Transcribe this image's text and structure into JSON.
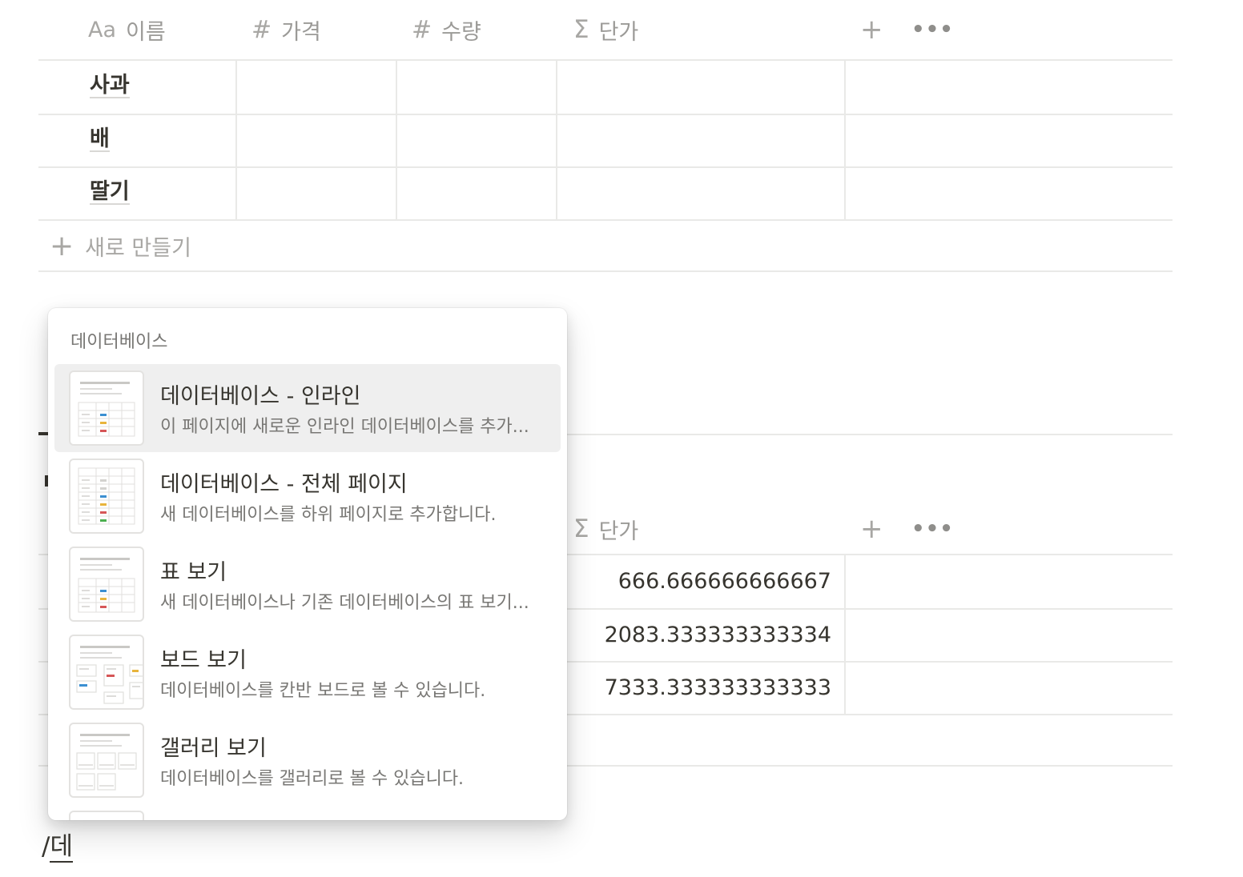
{
  "table1": {
    "headers": [
      {
        "icon": "Aa",
        "label": "이름"
      },
      {
        "icon": "#",
        "label": "가격"
      },
      {
        "icon": "#",
        "label": "수량"
      },
      {
        "icon": "Σ",
        "label": "단가"
      }
    ],
    "add_column": "+",
    "more": "•••",
    "rows": [
      {
        "name": "사과"
      },
      {
        "name": "배"
      },
      {
        "name": "딸기"
      }
    ],
    "new_row_plus": "+",
    "new_row_label": "새로 만들기"
  },
  "table2": {
    "header": {
      "icon": "Σ",
      "label": "단가"
    },
    "add_column": "+",
    "more": "•••",
    "values": [
      "666.666666666667",
      "2083.333333333334",
      "7333.333333333333"
    ]
  },
  "menu": {
    "heading": "데이터베이스",
    "items": [
      {
        "title": "데이터베이스 - 인라인",
        "desc": "이 페이지에 새로운 인라인 데이터베이스를 추가...",
        "icon": "inline-database-thumbnail"
      },
      {
        "title": "데이터베이스 - 전체 페이지",
        "desc": "새 데이터베이스를 하위 페이지로 추가합니다.",
        "icon": "full-page-database-thumbnail"
      },
      {
        "title": "표 보기",
        "desc": "새 데이터베이스나 기존 데이터베이스의 표 보기...",
        "icon": "table-view-thumbnail"
      },
      {
        "title": "보드 보기",
        "desc": "데이터베이스를 칸반 보드로 볼 수 있습니다.",
        "icon": "board-view-thumbnail"
      },
      {
        "title": "갤러리 보기",
        "desc": "데이터베이스를 갤러리로 볼 수 있습니다.",
        "icon": "gallery-view-thumbnail"
      }
    ]
  },
  "editor": {
    "slash": "/",
    "composing": "데"
  },
  "colors": {
    "text": "#37352f",
    "muted": "#9b9a97",
    "border": "#e9e9e7",
    "highlight": "#efefef",
    "tag_blue": "#3b8fd1",
    "tag_yellow": "#e8b43c",
    "tag_red": "#d65657",
    "tag_green": "#4caf50"
  }
}
